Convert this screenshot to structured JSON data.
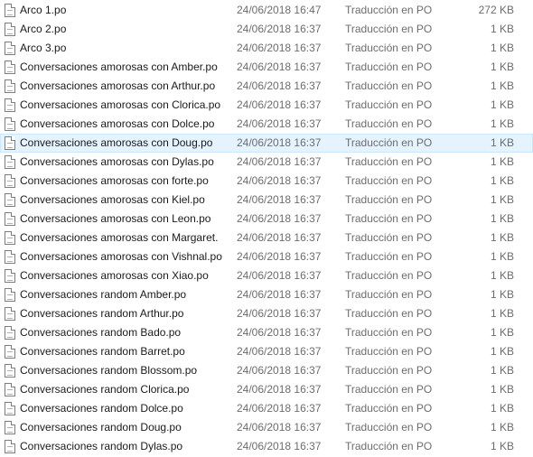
{
  "files": [
    {
      "name": "Arco 1.po",
      "date": "24/06/2018 16:47",
      "type": "Traducción en PO",
      "size": "272 KB"
    },
    {
      "name": "Arco 2.po",
      "date": "24/06/2018 16:37",
      "type": "Traducción en PO",
      "size": "1 KB"
    },
    {
      "name": "Arco 3.po",
      "date": "24/06/2018 16:37",
      "type": "Traducción en PO",
      "size": "1 KB"
    },
    {
      "name": "Conversaciones amorosas con Amber.po",
      "date": "24/06/2018 16:37",
      "type": "Traducción en PO",
      "size": "1 KB"
    },
    {
      "name": "Conversaciones amorosas con Arthur.po",
      "date": "24/06/2018 16:37",
      "type": "Traducción en PO",
      "size": "1 KB"
    },
    {
      "name": "Conversaciones amorosas con Clorica.po",
      "date": "24/06/2018 16:37",
      "type": "Traducción en PO",
      "size": "1 KB"
    },
    {
      "name": "Conversaciones amorosas con Dolce.po",
      "date": "24/06/2018 16:37",
      "type": "Traducción en PO",
      "size": "1 KB"
    },
    {
      "name": "Conversaciones amorosas con Doug.po",
      "date": "24/06/2018 16:37",
      "type": "Traducción en PO",
      "size": "1 KB",
      "selected": true
    },
    {
      "name": "Conversaciones amorosas con Dylas.po",
      "date": "24/06/2018 16:37",
      "type": "Traducción en PO",
      "size": "1 KB"
    },
    {
      "name": "Conversaciones amorosas con forte.po",
      "date": "24/06/2018 16:37",
      "type": "Traducción en PO",
      "size": "1 KB"
    },
    {
      "name": "Conversaciones amorosas con Kiel.po",
      "date": "24/06/2018 16:37",
      "type": "Traducción en PO",
      "size": "1 KB"
    },
    {
      "name": "Conversaciones amorosas con Leon.po",
      "date": "24/06/2018 16:37",
      "type": "Traducción en PO",
      "size": "1 KB"
    },
    {
      "name": "Conversaciones amorosas con Margaret.",
      "date": "24/06/2018 16:37",
      "type": "Traducción en PO",
      "size": "1 KB"
    },
    {
      "name": "Conversaciones amorosas con Vishnal.po",
      "date": "24/06/2018 16:37",
      "type": "Traducción en PO",
      "size": "1 KB"
    },
    {
      "name": "Conversaciones amorosas con Xiao.po",
      "date": "24/06/2018 16:37",
      "type": "Traducción en PO",
      "size": "1 KB"
    },
    {
      "name": "Conversaciones random Amber.po",
      "date": "24/06/2018 16:37",
      "type": "Traducción en PO",
      "size": "1 KB"
    },
    {
      "name": "Conversaciones random Arthur.po",
      "date": "24/06/2018 16:37",
      "type": "Traducción en PO",
      "size": "1 KB"
    },
    {
      "name": "Conversaciones random Bado.po",
      "date": "24/06/2018 16:37",
      "type": "Traducción en PO",
      "size": "1 KB"
    },
    {
      "name": "Conversaciones random Barret.po",
      "date": "24/06/2018 16:37",
      "type": "Traducción en PO",
      "size": "1 KB"
    },
    {
      "name": "Conversaciones random Blossom.po",
      "date": "24/06/2018 16:37",
      "type": "Traducción en PO",
      "size": "1 KB"
    },
    {
      "name": "Conversaciones random Clorica.po",
      "date": "24/06/2018 16:37",
      "type": "Traducción en PO",
      "size": "1 KB"
    },
    {
      "name": "Conversaciones random Dolce.po",
      "date": "24/06/2018 16:37",
      "type": "Traducción en PO",
      "size": "1 KB"
    },
    {
      "name": "Conversaciones random Doug.po",
      "date": "24/06/2018 16:37",
      "type": "Traducción en PO",
      "size": "1 KB"
    },
    {
      "name": "Conversaciones random Dylas.po",
      "date": "24/06/2018 16:37",
      "type": "Traducción en PO",
      "size": "1 KB"
    }
  ],
  "icon": "document-file-icon",
  "colors": {
    "selected_bg": "#e5f3ff",
    "selected_border": "#cce8ff",
    "meta_text": "#6d6d6d"
  }
}
